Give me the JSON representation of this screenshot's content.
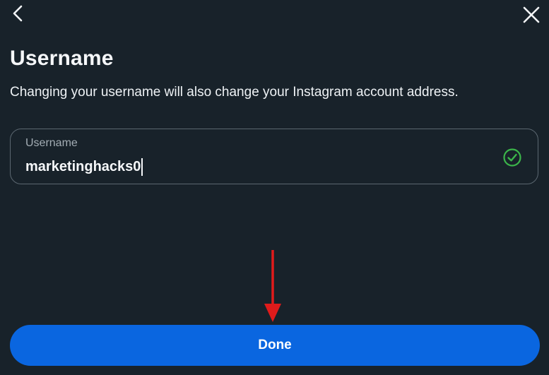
{
  "header": {
    "back_icon": "chevron-left-icon",
    "close_icon": "close-icon"
  },
  "title": "Username",
  "description": "Changing your username will also change your Instagram account address.",
  "username_field": {
    "label": "Username",
    "value": "marketinghacks0",
    "status_icon": "check-circle-icon",
    "status_color": "#3bb54a"
  },
  "annotation": {
    "arrow_icon": "arrow-down-icon",
    "color": "#e01b1b"
  },
  "done_button": {
    "label": "Done",
    "color": "#0a66e0"
  }
}
